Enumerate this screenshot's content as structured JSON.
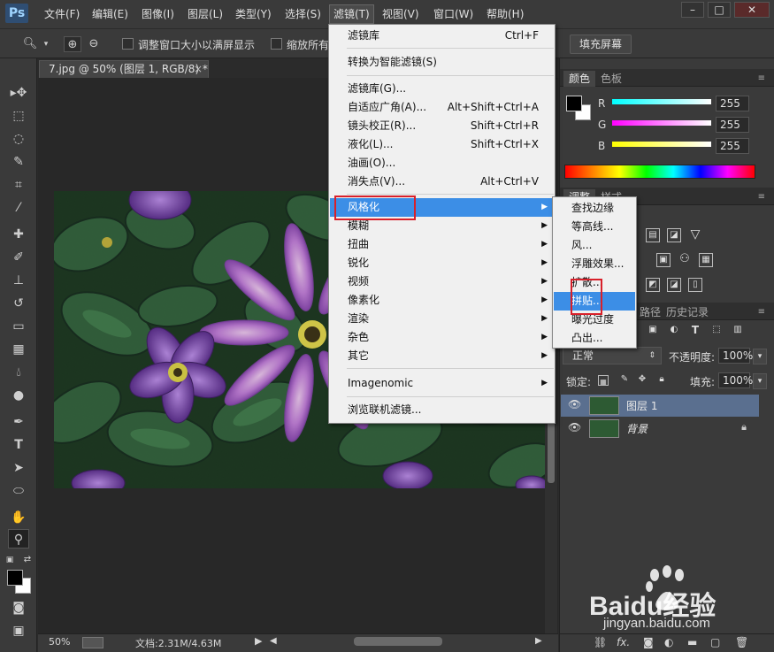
{
  "app": {
    "logo": "Ps"
  },
  "menubar": {
    "items": [
      "文件(F)",
      "编辑(E)",
      "图像(I)",
      "图层(L)",
      "类型(Y)",
      "选择(S)",
      "滤镜(T)",
      "视图(V)",
      "窗口(W)",
      "帮助(H)"
    ],
    "active": "滤镜(T)",
    "window_controls": [
      "–",
      "□",
      "✕"
    ]
  },
  "options": {
    "checkbox1_label": "调整窗口大小以满屏显示",
    "checkbox2_label": "缩放所有",
    "fill_screen_button": "填充屏幕"
  },
  "document": {
    "tab_title": "7.jpg @ 50% (图层 1, RGB/8) *",
    "tab_close": "×",
    "zoom": "50%",
    "doc_size": "文档:2.31M/4.63M"
  },
  "filter_menu": {
    "items": [
      {
        "label": "滤镜库",
        "shortcut": "Ctrl+F"
      },
      {
        "label": "转换为智能滤镜(S)",
        "shortcut": ""
      },
      {
        "label": "滤镜库(G)...",
        "shortcut": ""
      },
      {
        "label": "自适应广角(A)...",
        "shortcut": "Alt+Shift+Ctrl+A"
      },
      {
        "label": "镜头校正(R)...",
        "shortcut": "Shift+Ctrl+R"
      },
      {
        "label": "液化(L)...",
        "shortcut": "Shift+Ctrl+X"
      },
      {
        "label": "油画(O)...",
        "shortcut": ""
      },
      {
        "label": "消失点(V)...",
        "shortcut": "Alt+Ctrl+V"
      },
      {
        "label": "风格化",
        "shortcut": ""
      },
      {
        "label": "模糊",
        "shortcut": ""
      },
      {
        "label": "扭曲",
        "shortcut": ""
      },
      {
        "label": "锐化",
        "shortcut": ""
      },
      {
        "label": "视频",
        "shortcut": ""
      },
      {
        "label": "像素化",
        "shortcut": ""
      },
      {
        "label": "渲染",
        "shortcut": ""
      },
      {
        "label": "杂色",
        "shortcut": ""
      },
      {
        "label": "其它",
        "shortcut": ""
      },
      {
        "label": "Imagenomic",
        "shortcut": ""
      },
      {
        "label": "浏览联机滤镜...",
        "shortcut": ""
      }
    ],
    "highlighted": "风格化"
  },
  "stylize_submenu": {
    "items": [
      "查找边缘",
      "等高线...",
      "风...",
      "浮雕效果...",
      "扩散...",
      "拼贴...",
      "曝光过度",
      "凸出..."
    ],
    "highlighted": "拼贴..."
  },
  "color_panel": {
    "tabs": [
      "颜色",
      "色板"
    ],
    "r_label": "R",
    "g_label": "G",
    "b_label": "B",
    "r_value": "255",
    "g_value": "255",
    "b_value": "255"
  },
  "adjust_panel": {
    "tabs": [
      "调整",
      "样式"
    ]
  },
  "layers_panel": {
    "tabs": [
      "路径",
      "历史记录"
    ],
    "blend_mode": "正常",
    "opacity_label": "不透明度:",
    "opacity_value": "100%",
    "lock_label": "锁定:",
    "fill_label": "填充:",
    "fill_value": "100%",
    "layers": [
      {
        "name": "图层 1",
        "selected": true
      },
      {
        "name": "背景",
        "selected": false
      }
    ],
    "footer_fx": "fx."
  },
  "watermark": {
    "brand": "Baidu经验",
    "url": "jingyan.baidu.com"
  },
  "colors": {
    "menu_highlight": "#3c8ee6",
    "red_annotation": "#d8202a",
    "ui_dark": "#3a3a3a"
  }
}
